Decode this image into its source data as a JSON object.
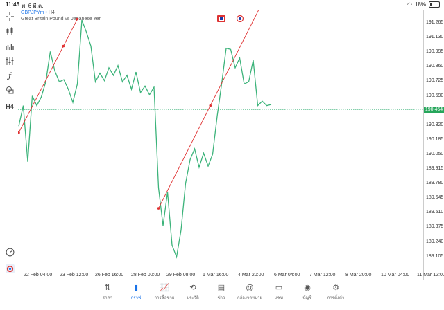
{
  "status_bar": {
    "time": "11:45",
    "date": "พ. 6 มี.ค.",
    "battery": "18%"
  },
  "symbol": {
    "code": "GBPJPYm",
    "separator": "•",
    "timeframe": "H4",
    "description": "Great Britain Pound vs Japanese Yen"
  },
  "price_axis": {
    "labels": [
      "191.265",
      "191.130",
      "190.995",
      "190.860",
      "190.725",
      "190.590",
      "190.320",
      "190.185",
      "190.050",
      "189.915",
      "189.780",
      "189.645",
      "189.510",
      "189.375",
      "189.240",
      "189.105"
    ],
    "current": "190.464"
  },
  "time_axis": {
    "labels": [
      "22 Feb 04:00",
      "23 Feb 12:00",
      "26 Feb 16:00",
      "28 Feb 00:00",
      "29 Feb 08:00",
      "1 Mar 16:00",
      "4 Mar 20:00",
      "6 Mar 04:00",
      "7 Mar 12:00",
      "8 Mar 20:00",
      "10 Mar 04:00",
      "11 Mar 12:00"
    ]
  },
  "colors": {
    "line": "#3cb37a",
    "trend": "#e03131",
    "current_price_bg": "#26a65b",
    "accent": "#1a73e8"
  },
  "toolbar_icons": [
    "crosshair-icon",
    "candles-icon",
    "bars-icon",
    "indicators-icon",
    "function-icon",
    "objects-icon",
    "timeframe-icon"
  ],
  "timeframe_label": "H4",
  "bottom_nav": [
    {
      "label": "ราคา",
      "icon": "quotes-icon"
    },
    {
      "label": "กราฟ",
      "icon": "chart-icon",
      "active": true
    },
    {
      "label": "การซื้อขาย",
      "icon": "trade-icon"
    },
    {
      "label": "ประวัติ",
      "icon": "history-icon"
    },
    {
      "label": "ข่าว",
      "icon": "news-icon"
    },
    {
      "label": "กล่องจดหมาย",
      "icon": "mailbox-icon"
    },
    {
      "label": "แชท",
      "icon": "chat-icon"
    },
    {
      "label": "บัญชี",
      "icon": "account-icon"
    },
    {
      "label": "การตั้งค่า",
      "icon": "settings-icon"
    }
  ],
  "chart_data": {
    "type": "line",
    "price_series": [
      190.31,
      190.5,
      189.98,
      190.59,
      190.5,
      190.58,
      190.72,
      191.0,
      190.82,
      190.72,
      190.74,
      190.65,
      190.53,
      190.7,
      191.29,
      191.18,
      191.05,
      190.72,
      190.8,
      190.73,
      190.85,
      190.78,
      190.87,
      190.72,
      190.78,
      190.65,
      190.81,
      190.62,
      190.68,
      190.6,
      190.67,
      189.74,
      189.39,
      189.7,
      189.21,
      189.1,
      189.35,
      189.78,
      190.0,
      190.1,
      189.93,
      190.06,
      189.94,
      190.05,
      190.4,
      190.7,
      191.03,
      191.02,
      190.85,
      190.94,
      190.7,
      190.72,
      190.92,
      190.5,
      190.54,
      190.5,
      190.51
    ],
    "trendlines": [
      {
        "from_index": 0,
        "from_price": 190.25,
        "to_index": 13,
        "to_price": 191.3,
        "mid_price": 191.05
      },
      {
        "from_index": 31,
        "from_price": 189.55,
        "to_index": 54,
        "to_price": 191.45,
        "mid_price": 190.5
      }
    ]
  }
}
